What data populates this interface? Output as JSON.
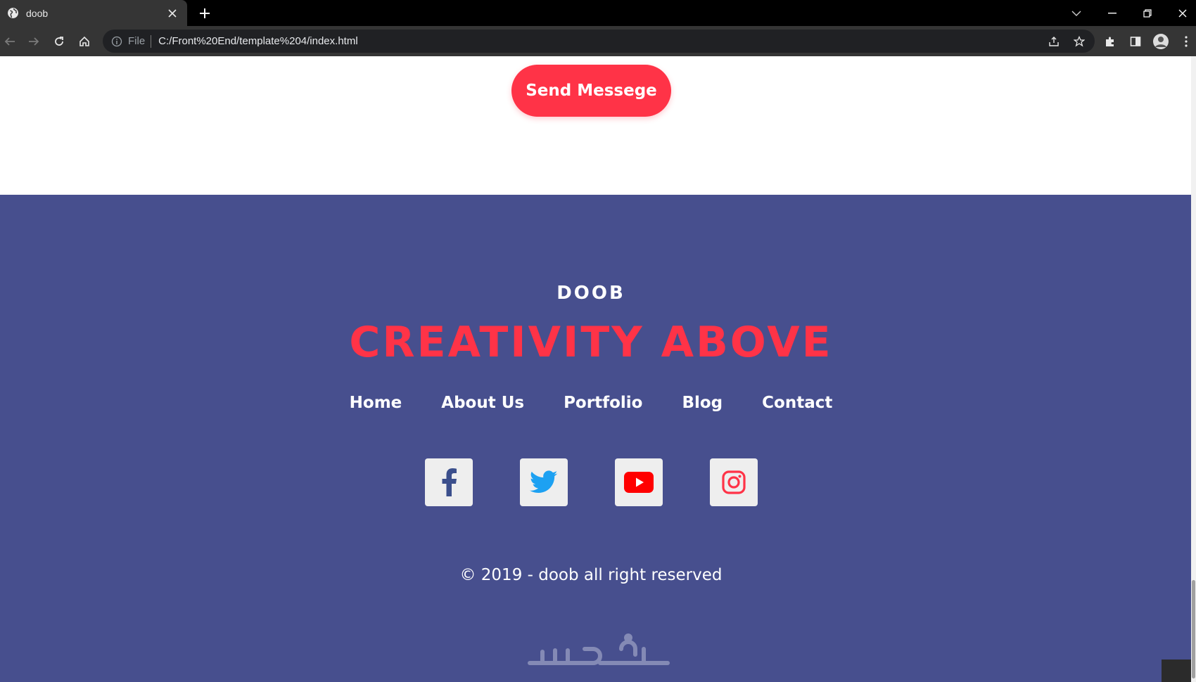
{
  "browser": {
    "tab_title": "doob",
    "omnibox": {
      "chip": "File",
      "url": "C:/Front%20End/template%204/index.html"
    }
  },
  "page": {
    "send_button_label": "Send Messege",
    "footer": {
      "brand": "DOOB",
      "tagline": "CREATIVITY ABOVE",
      "nav": [
        "Home",
        "About Us",
        "Portfolio",
        "Blog",
        "Contact"
      ],
      "socials": [
        {
          "icon": "facebook-icon",
          "color": "#3b4f8c"
        },
        {
          "icon": "twitter-icon",
          "color": "#1da1f2"
        },
        {
          "icon": "youtube-icon",
          "color": "#ff0000"
        },
        {
          "icon": "instagram-icon",
          "color": "#ff3347"
        }
      ],
      "copyright": "© 2019 - doob all right reserved",
      "watermark": "خمسات"
    }
  },
  "colors": {
    "footer_bg": "#474f8e",
    "accent": "#ff3347"
  }
}
